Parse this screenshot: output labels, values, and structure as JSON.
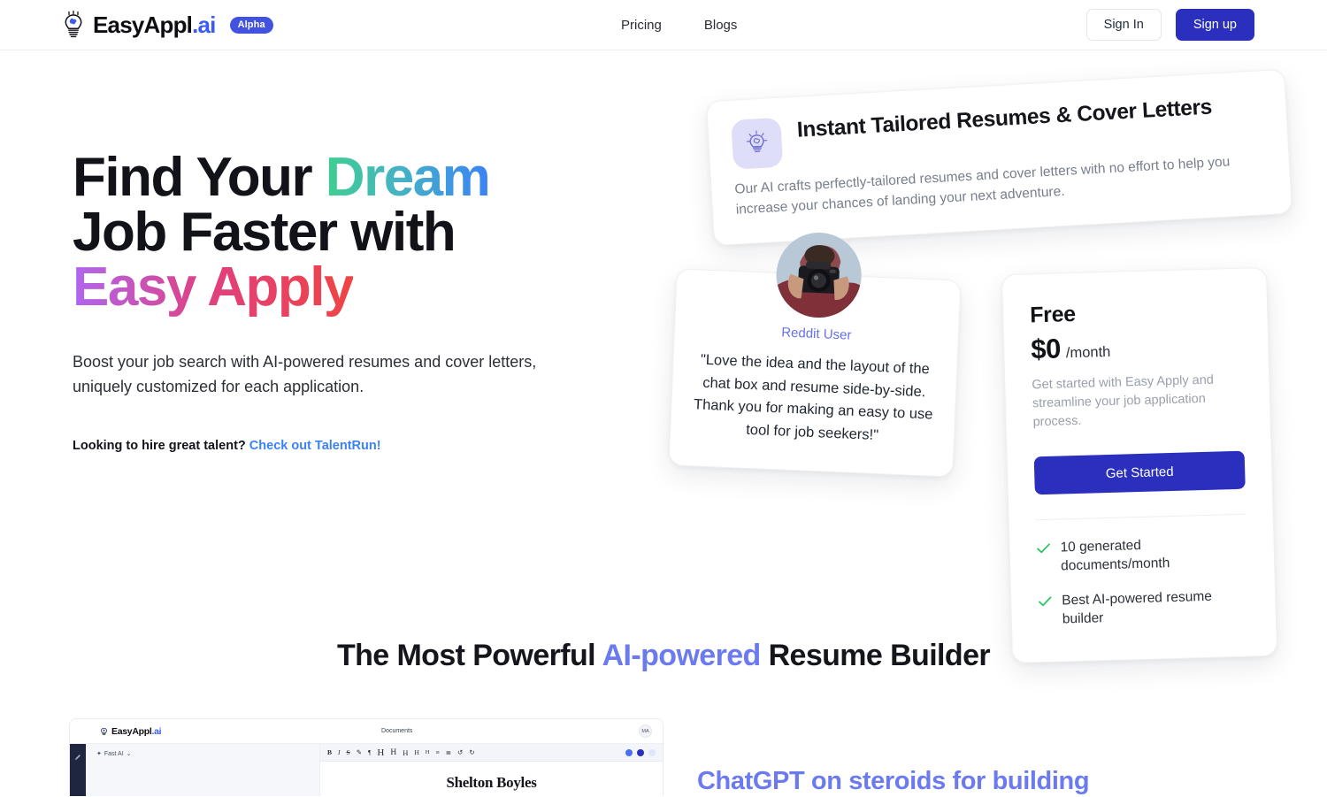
{
  "header": {
    "brand_name": "EasyAppl",
    "brand_suffix": ".ai",
    "badge": "Alpha",
    "nav": [
      {
        "label": "Pricing"
      },
      {
        "label": "Blogs"
      }
    ],
    "sign_in_label": "Sign In",
    "sign_up_label": "Sign up"
  },
  "hero": {
    "title_line1_plain": "Find Your ",
    "title_line1_accent": "Dream",
    "title_line2": "Job Faster with",
    "title_line3_accent": "Easy Apply",
    "subtitle": "Boost your job search with AI-powered resumes and cover letters, uniquely customized for each application.",
    "talent_prompt": "Looking to hire great talent?",
    "talent_link": "Check out TalentRun!"
  },
  "feature_card": {
    "icon": "lightbulb-icon",
    "title": "Instant Tailored Resumes & Cover Letters",
    "description": "Our AI crafts perfectly-tailored resumes and cover letters with no effort to help you increase your chances of landing your next adventure."
  },
  "testimonial": {
    "avatar": "user-photo-avatar",
    "name": "Reddit User",
    "quote": "\"Love the idea and the layout of the chat box and resume side-by-side. Thank you for making an easy to use tool for job seekers!\""
  },
  "pricing": {
    "plan": "Free",
    "amount": "$0",
    "period": "/month",
    "description": "Get started with Easy Apply and streamline your job application process.",
    "cta_label": "Get Started",
    "features": [
      {
        "label": "10 generated documents/month"
      },
      {
        "label": "Best AI-powered resume builder"
      }
    ]
  },
  "section2": {
    "title_part1": "The Most Powerful ",
    "title_accent": "AI-powered",
    "title_part2": " Resume Builder",
    "right_heading": "ChatGPT on steroids for building",
    "app": {
      "brand_name": "EasyAppl",
      "brand_suffix": ".ai",
      "documents_tab": "Documents",
      "avatar_initials": "MA",
      "model_selector": "Fast AI",
      "doc_title": "Shelton Boyles",
      "toolbar": [
        {
          "label": "B",
          "name": "bold-icon"
        },
        {
          "label": "I",
          "name": "italic-icon"
        },
        {
          "label": "S",
          "name": "strikethrough-icon"
        },
        {
          "label": "✎",
          "name": "highlight-icon"
        },
        {
          "label": "¶",
          "name": "paragraph-icon"
        },
        {
          "label": "H",
          "name": "heading1-icon"
        },
        {
          "label": "H",
          "name": "heading2-icon"
        },
        {
          "label": "H",
          "name": "heading3-icon"
        },
        {
          "label": "H",
          "name": "heading4-icon"
        },
        {
          "label": "H",
          "name": "heading5-icon"
        },
        {
          "label": "≡",
          "name": "bullet-list-icon"
        },
        {
          "label": "≣",
          "name": "numbered-list-icon"
        },
        {
          "label": "↺",
          "name": "undo-icon"
        },
        {
          "label": "↻",
          "name": "redo-icon"
        }
      ]
    }
  },
  "colors": {
    "primary": "#2a2fbe",
    "accent_blue": "#3b5bf5",
    "link_blue": "#3b82f6",
    "periwinkle": "#6b7bef",
    "check_green": "#22c55e",
    "dream_gradient_start": "#3ecf8e",
    "dream_gradient_end": "#3b82f6",
    "easy_gradient_start": "#b066f0",
    "easy_gradient_end": "#ef4444"
  }
}
